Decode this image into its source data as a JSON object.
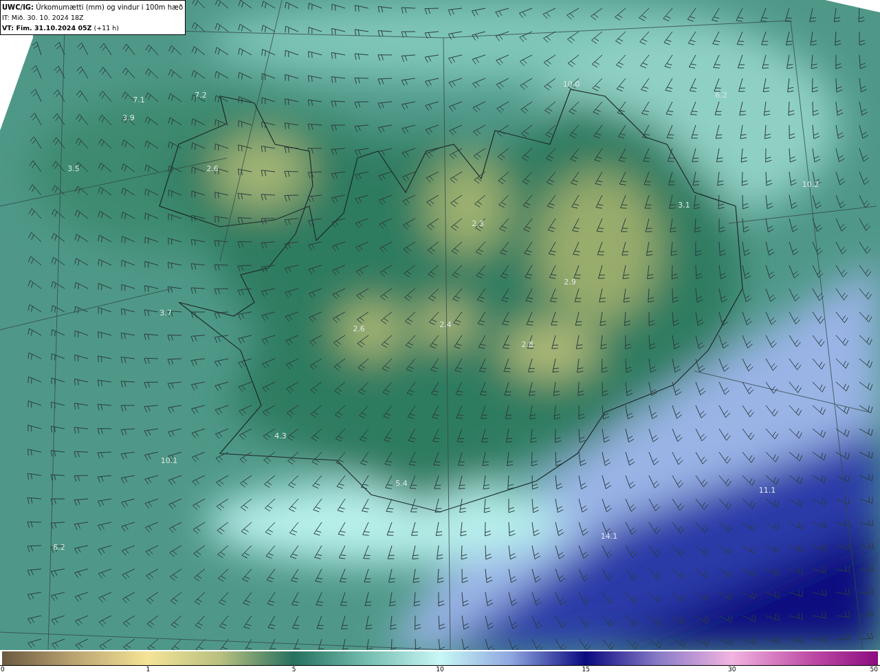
{
  "header": {
    "lines": [
      "**UWC/IG:** Úrkomumætti (mm) og vindur i 100m hæð",
      "IT: Mið. 30. 10. 2024 18Z",
      "**VT: Fim. 31.10.2024 05Z** (+11 h)"
    ]
  },
  "map_values": [
    "7.1",
    "7.2",
    "3.9",
    "3.5",
    "2.6",
    "10.0",
    "6.2",
    "10.2",
    "3.1",
    "2.3",
    "2.9",
    "3.7",
    "2.6",
    "2.4",
    "2.8",
    "4.3",
    "10.1",
    "5.4",
    "11.1",
    "14.1",
    "6.2"
  ],
  "color_scale": {
    "ticks": [
      "0",
      "1",
      "5",
      "10",
      "15",
      "30",
      "50"
    ]
  }
}
